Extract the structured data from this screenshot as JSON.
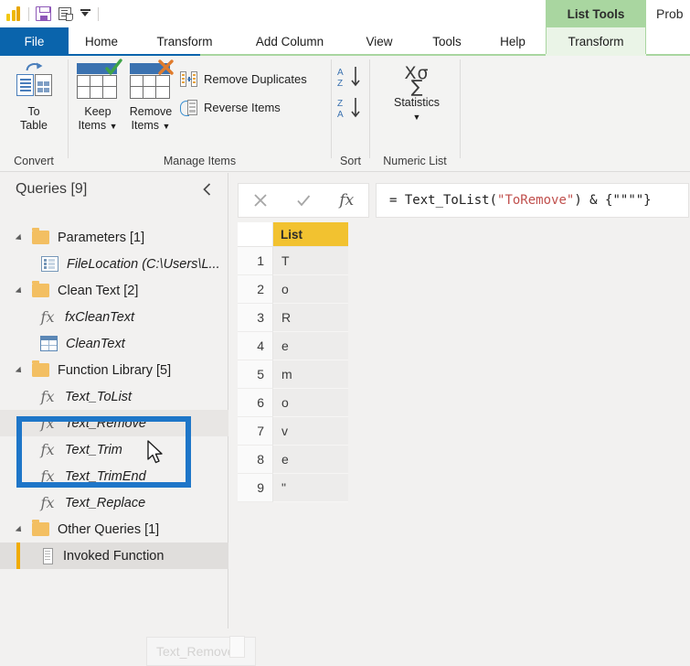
{
  "quick_access": {
    "items": [
      {
        "name": "powerbi-logo",
        "label": "Power BI"
      },
      {
        "name": "save-icon",
        "label": "Save"
      },
      {
        "name": "advanced-editor-icon",
        "label": "Advanced Editor"
      },
      {
        "name": "customize-qat-icon",
        "label": "Customize Quick Access Toolbar"
      }
    ]
  },
  "contextual": {
    "tools_label": "List Tools",
    "right_partial_label": "Prob"
  },
  "tabs": [
    {
      "label": "File",
      "state": "file"
    },
    {
      "label": "Home",
      "state": "normal"
    },
    {
      "label": "Transform",
      "state": "normal"
    },
    {
      "label": "Add Column",
      "state": "normal"
    },
    {
      "label": "View",
      "state": "normal"
    },
    {
      "label": "Tools",
      "state": "normal"
    },
    {
      "label": "Help",
      "state": "normal"
    },
    {
      "label": "Transform",
      "state": "contextual-selected"
    }
  ],
  "ribbon": {
    "groups": [
      {
        "label": "Convert"
      },
      {
        "label": "Manage Items"
      },
      {
        "label": "Sort"
      },
      {
        "label": "Numeric List"
      }
    ],
    "buttons": {
      "to_table_line1": "To",
      "to_table_line2": "Table",
      "keep_items_line1": "Keep",
      "keep_items_line2": "Items",
      "remove_items_line1": "Remove",
      "remove_items_line2": "Items",
      "remove_duplicates": "Remove Duplicates",
      "reverse_items": "Reverse Items",
      "statistics": "Statistics",
      "sort_asc": "Sort Ascending",
      "sort_desc": "Sort Descending"
    }
  },
  "queries_pane": {
    "title": "Queries [9]",
    "collapse_icon": "chevron-left-icon",
    "tree": [
      {
        "type": "folder",
        "label": "Parameters [1]",
        "indent": 0
      },
      {
        "type": "parameter",
        "label": "FileLocation (C:\\Users\\L...",
        "indent": 1
      },
      {
        "type": "folder",
        "label": "Clean Text [2]",
        "indent": 0
      },
      {
        "type": "function",
        "label": "fxCleanText",
        "indent": 1
      },
      {
        "type": "table",
        "label": "CleanText",
        "indent": 1
      },
      {
        "type": "folder",
        "label": "Function Library [5]",
        "indent": 0
      },
      {
        "type": "function",
        "label": "Text_ToList",
        "indent": 1
      },
      {
        "type": "function",
        "label": "Text_Remove",
        "indent": 1,
        "hover": true
      },
      {
        "type": "function",
        "label": "Text_Trim",
        "indent": 1
      },
      {
        "type": "function",
        "label": "Text_TrimEnd",
        "indent": 1
      },
      {
        "type": "function",
        "label": "Text_Replace",
        "indent": 1
      },
      {
        "type": "folder",
        "label": "Other Queries [1]",
        "indent": 0
      },
      {
        "type": "list",
        "label": "Invoked Function",
        "indent": 1,
        "selected": true
      }
    ],
    "tooltip": "Text_Remove",
    "highlight_color": "#1E76C8"
  },
  "formula_bar": {
    "cancel_icon": "close-icon",
    "accept_icon": "check-icon",
    "fx_icon": "fx-icon",
    "prefix": "= Text_ToList(",
    "string_arg": "\"ToRemove\"",
    "suffix": ") & {\"\"\"\"}",
    "full_text": "= Text_ToList(\"ToRemove\") & {\"\"\"\"}"
  },
  "data_grid": {
    "column_header": "List",
    "header_color": "#F2C230",
    "rows": [
      {
        "index": "1",
        "value": "T"
      },
      {
        "index": "2",
        "value": "o"
      },
      {
        "index": "3",
        "value": "R"
      },
      {
        "index": "4",
        "value": "e"
      },
      {
        "index": "5",
        "value": "m"
      },
      {
        "index": "6",
        "value": "o"
      },
      {
        "index": "7",
        "value": "v"
      },
      {
        "index": "8",
        "value": "e"
      },
      {
        "index": "9",
        "value": "\""
      }
    ]
  }
}
